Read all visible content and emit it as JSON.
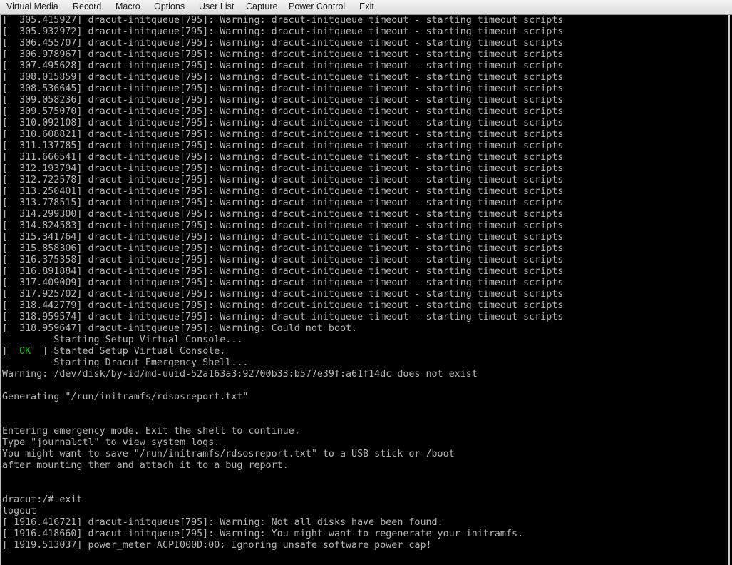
{
  "menu": {
    "items": [
      "Virtual Media",
      "Record",
      "Macro",
      "Options",
      "User List",
      "Capture",
      "Power Control",
      "Exit"
    ]
  },
  "colors": {
    "terminal_text": "#b4b4b4",
    "ok": "#2fb52f",
    "background": "#000000"
  },
  "terminal": {
    "lines": [
      {
        "text": "[  305.415927] dracut-initqueue[795]: Warning: dracut-initqueue timeout - starting timeout scripts"
      },
      {
        "text": "[  305.932972] dracut-initqueue[795]: Warning: dracut-initqueue timeout - starting timeout scripts"
      },
      {
        "text": "[  306.455707] dracut-initqueue[795]: Warning: dracut-initqueue timeout - starting timeout scripts"
      },
      {
        "text": "[  306.978967] dracut-initqueue[795]: Warning: dracut-initqueue timeout - starting timeout scripts"
      },
      {
        "text": "[  307.495628] dracut-initqueue[795]: Warning: dracut-initqueue timeout - starting timeout scripts"
      },
      {
        "text": "[  308.015859] dracut-initqueue[795]: Warning: dracut-initqueue timeout - starting timeout scripts"
      },
      {
        "text": "[  308.536645] dracut-initqueue[795]: Warning: dracut-initqueue timeout - starting timeout scripts"
      },
      {
        "text": "[  309.058236] dracut-initqueue[795]: Warning: dracut-initqueue timeout - starting timeout scripts"
      },
      {
        "text": "[  309.575070] dracut-initqueue[795]: Warning: dracut-initqueue timeout - starting timeout scripts"
      },
      {
        "text": "[  310.092108] dracut-initqueue[795]: Warning: dracut-initqueue timeout - starting timeout scripts"
      },
      {
        "text": "[  310.608821] dracut-initqueue[795]: Warning: dracut-initqueue timeout - starting timeout scripts"
      },
      {
        "text": "[  311.137785] dracut-initqueue[795]: Warning: dracut-initqueue timeout - starting timeout scripts"
      },
      {
        "text": "[  311.666541] dracut-initqueue[795]: Warning: dracut-initqueue timeout - starting timeout scripts"
      },
      {
        "text": "[  312.193794] dracut-initqueue[795]: Warning: dracut-initqueue timeout - starting timeout scripts"
      },
      {
        "text": "[  312.722578] dracut-initqueue[795]: Warning: dracut-initqueue timeout - starting timeout scripts"
      },
      {
        "text": "[  313.250401] dracut-initqueue[795]: Warning: dracut-initqueue timeout - starting timeout scripts"
      },
      {
        "text": "[  313.778515] dracut-initqueue[795]: Warning: dracut-initqueue timeout - starting timeout scripts"
      },
      {
        "text": "[  314.299300] dracut-initqueue[795]: Warning: dracut-initqueue timeout - starting timeout scripts"
      },
      {
        "text": "[  314.824583] dracut-initqueue[795]: Warning: dracut-initqueue timeout - starting timeout scripts"
      },
      {
        "text": "[  315.341764] dracut-initqueue[795]: Warning: dracut-initqueue timeout - starting timeout scripts"
      },
      {
        "text": "[  315.858306] dracut-initqueue[795]: Warning: dracut-initqueue timeout - starting timeout scripts"
      },
      {
        "text": "[  316.375358] dracut-initqueue[795]: Warning: dracut-initqueue timeout - starting timeout scripts"
      },
      {
        "text": "[  316.891884] dracut-initqueue[795]: Warning: dracut-initqueue timeout - starting timeout scripts"
      },
      {
        "text": "[  317.409009] dracut-initqueue[795]: Warning: dracut-initqueue timeout - starting timeout scripts"
      },
      {
        "text": "[  317.925702] dracut-initqueue[795]: Warning: dracut-initqueue timeout - starting timeout scripts"
      },
      {
        "text": "[  318.442779] dracut-initqueue[795]: Warning: dracut-initqueue timeout - starting timeout scripts"
      },
      {
        "text": "[  318.959574] dracut-initqueue[795]: Warning: dracut-initqueue timeout - starting timeout scripts"
      },
      {
        "text": "[  318.959647] dracut-initqueue[795]: Warning: Could not boot."
      },
      {
        "text": "         Starting Setup Virtual Console..."
      },
      {
        "pre": "[  ",
        "ok": "OK",
        "text": "  ] Started Setup Virtual Console."
      },
      {
        "text": "         Starting Dracut Emergency Shell..."
      },
      {
        "text": "Warning: /dev/disk/by-id/md-uuid-52a163a3:92700b33:b577e39f:a61f14dc does not exist"
      },
      {
        "text": ""
      },
      {
        "text": "Generating \"/run/initramfs/rdsosreport.txt\""
      },
      {
        "text": ""
      },
      {
        "text": ""
      },
      {
        "text": "Entering emergency mode. Exit the shell to continue."
      },
      {
        "text": "Type \"journalctl\" to view system logs."
      },
      {
        "text": "You might want to save \"/run/initramfs/rdsosreport.txt\" to a USB stick or /boot"
      },
      {
        "text": "after mounting them and attach it to a bug report."
      },
      {
        "text": ""
      },
      {
        "text": ""
      },
      {
        "text": "dracut:/# exit"
      },
      {
        "text": "logout"
      },
      {
        "text": "[ 1916.416721] dracut-initqueue[795]: Warning: Not all disks have been found."
      },
      {
        "text": "[ 1916.418660] dracut-initqueue[795]: Warning: You might want to regenerate your initramfs."
      },
      {
        "text": "[ 1919.513037] power_meter ACPI000D:00: Ignoring unsafe software power cap!"
      }
    ]
  }
}
